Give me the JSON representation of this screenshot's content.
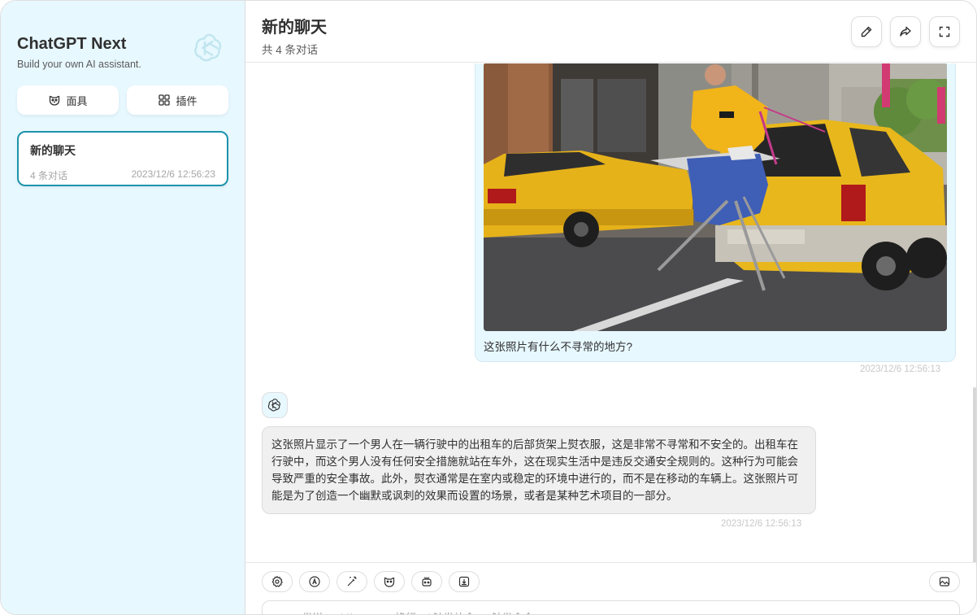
{
  "sidebar": {
    "title": "ChatGPT Next",
    "subtitle": "Build your own AI assistant.",
    "mask_label": "面具",
    "plugin_label": "插件",
    "chats": [
      {
        "title": "新的聊天",
        "count": "4 条对话",
        "date": "2023/12/6 12:56:23"
      }
    ]
  },
  "header": {
    "title": "新的聊天",
    "subtitle": "共 4 条对话"
  },
  "messages": {
    "user": {
      "text": "这张照片有什么不寻常的地方?",
      "date": "2023/12/6 12:56:13"
    },
    "bot": {
      "text": "这张照片显示了一个男人在一辆行驶中的出租车的后部货架上熨衣服，这是非常不寻常和不安全的。出租车在行驶中，而这个男人没有任何安全措施就站在车外，这在现实生活中是违反交通安全规则的。这种行为可能会导致严重的安全事故。此外，熨衣通常是在室内或稳定的环境中进行的，而不是在移动的车辆上。这张照片可能是为了创造一个幽默或讽刺的效果而设置的场景，或者是某种艺术项目的一部分。",
      "date": "2023/12/6 12:56:13"
    }
  },
  "input": {
    "placeholder": "Enter 发送，Shift + Enter 换行，/ 触发补全，: 触发命令"
  },
  "colors": {
    "sidebar_bg": "#e7f8ff",
    "accent": "#1d93ab",
    "bot_bubble": "#f0f0f0",
    "user_bubble": "#e7f8ff"
  }
}
